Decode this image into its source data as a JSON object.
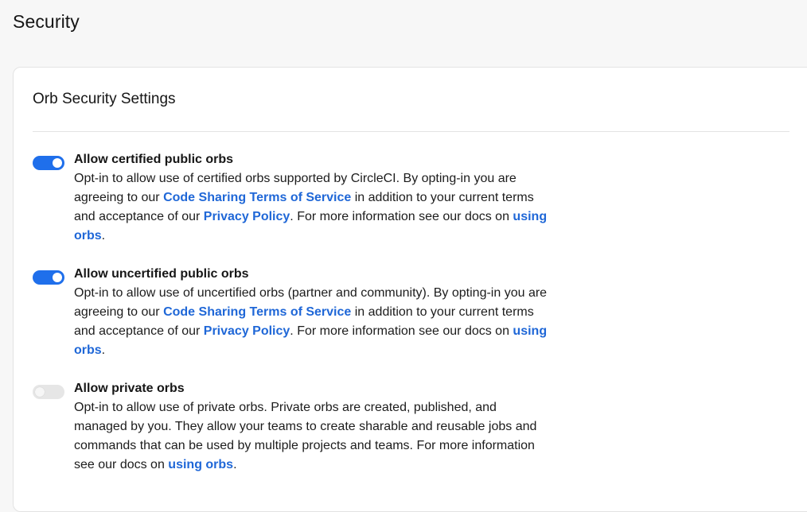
{
  "page": {
    "title": "Security"
  },
  "card": {
    "title": "Orb Security Settings"
  },
  "settings": [
    {
      "label": "Allow certified public orbs",
      "enabled": true,
      "desc_1": "Opt-in to allow use of certified orbs supported by CircleCI. By opting-in you are agreeing to our ",
      "link_terms": "Code Sharing Terms of Service",
      "desc_2": " in addition to your current terms and acceptance of our ",
      "link_privacy": "Privacy Policy",
      "desc_3": ". For more information see our docs on ",
      "link_docs": "using orbs",
      "desc_4": "."
    },
    {
      "label": "Allow uncertified public orbs",
      "enabled": true,
      "desc_1": "Opt-in to allow use of uncertified orbs (partner and community). By opting-in you are agreeing to our ",
      "link_terms": "Code Sharing Terms of Service",
      "desc_2": " in addition to your current terms and acceptance of our ",
      "link_privacy": "Privacy Policy",
      "desc_3": ". For more information see our docs on ",
      "link_docs": "using orbs",
      "desc_4": "."
    },
    {
      "label": "Allow private orbs",
      "enabled": false,
      "desc_1": "Opt-in to allow use of private orbs. Private orbs are created, published, and managed by you. They allow your teams to create sharable and reusable jobs and commands that can be used by multiple projects and teams. For more information see our docs on ",
      "link_docs": "using orbs",
      "desc_2": "."
    }
  ],
  "colors": {
    "accent": "#1f6feb",
    "link": "#1f67d7",
    "toggle_off": "#e6e6e6",
    "page_bg": "#f7f7f7",
    "card_bg": "#ffffff"
  }
}
